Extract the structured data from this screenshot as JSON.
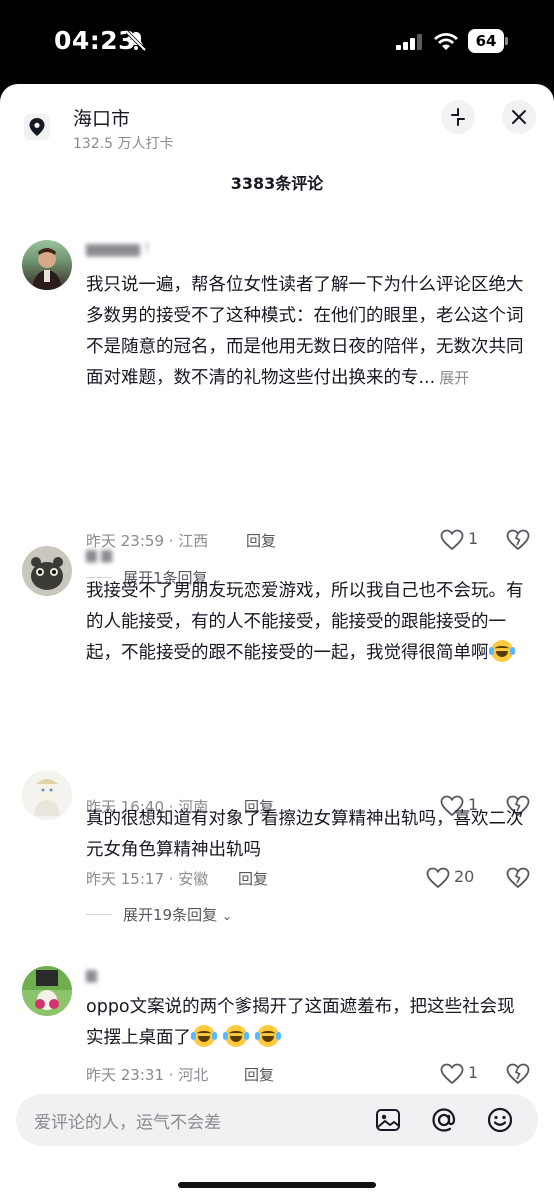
{
  "status_bar": {
    "time": "04:23",
    "battery": "64"
  },
  "location": {
    "name": "海口市",
    "checkins": "132.5 万人打卡"
  },
  "comments_header": {
    "count_label": "3383条评论"
  },
  "comments": [
    {
      "username": "▆▆▆▆▆ !",
      "text": "我只说一遍，帮各位女性读者了解一下为什么评论区绝大多数男的接受不了这种模式：在他们的眼里，老公这个词不是随意的冠名，而是他用无数日夜的陪伴，无数次共同面对难题，数不清的礼物这些付出换来的专...",
      "expand": "展开",
      "time_location": "昨天 23:59 · 江西",
      "reply": "回复",
      "likes": "1",
      "replies_label": "展开1条回复"
    },
    {
      "username": "▆ ▆",
      "text": "我接受不了男朋友玩恋爱游戏，所以我自己也不会玩。有的人能接受，有的人不能接受，能接受的跟能接受的一起，不能接受的跟不能接受的一起，我觉得很简单啊",
      "time_location": "昨天 16:40 · 河南",
      "reply": "回复",
      "likes": "1"
    },
    {
      "username": "",
      "text": "真的很想知道有对象了看擦边女算精神出轨吗，喜欢二次元女角色算精神出轨吗",
      "time_location": "昨天 15:17 · 安徽",
      "reply": "回复",
      "likes": "20",
      "replies_label": "展开19条回复"
    },
    {
      "username": "▆",
      "text": "oppo文案说的两个爹揭开了这面遮羞布，把这些社会现实摆上桌面了",
      "time_location": "昨天 23:31 · 河北",
      "reply": "回复",
      "likes": "1"
    }
  ],
  "input_bar": {
    "placeholder": "爱评论的人，运气不会差"
  },
  "icons": {
    "bell_muted": "bell-slash-icon",
    "location": "location-pin-icon",
    "collapse": "collapse-icon",
    "close": "close-icon",
    "like": "heart-outline-icon",
    "dislike": "broken-heart-icon",
    "image": "image-icon",
    "mention": "at-icon",
    "emoji": "emoji-icon"
  }
}
